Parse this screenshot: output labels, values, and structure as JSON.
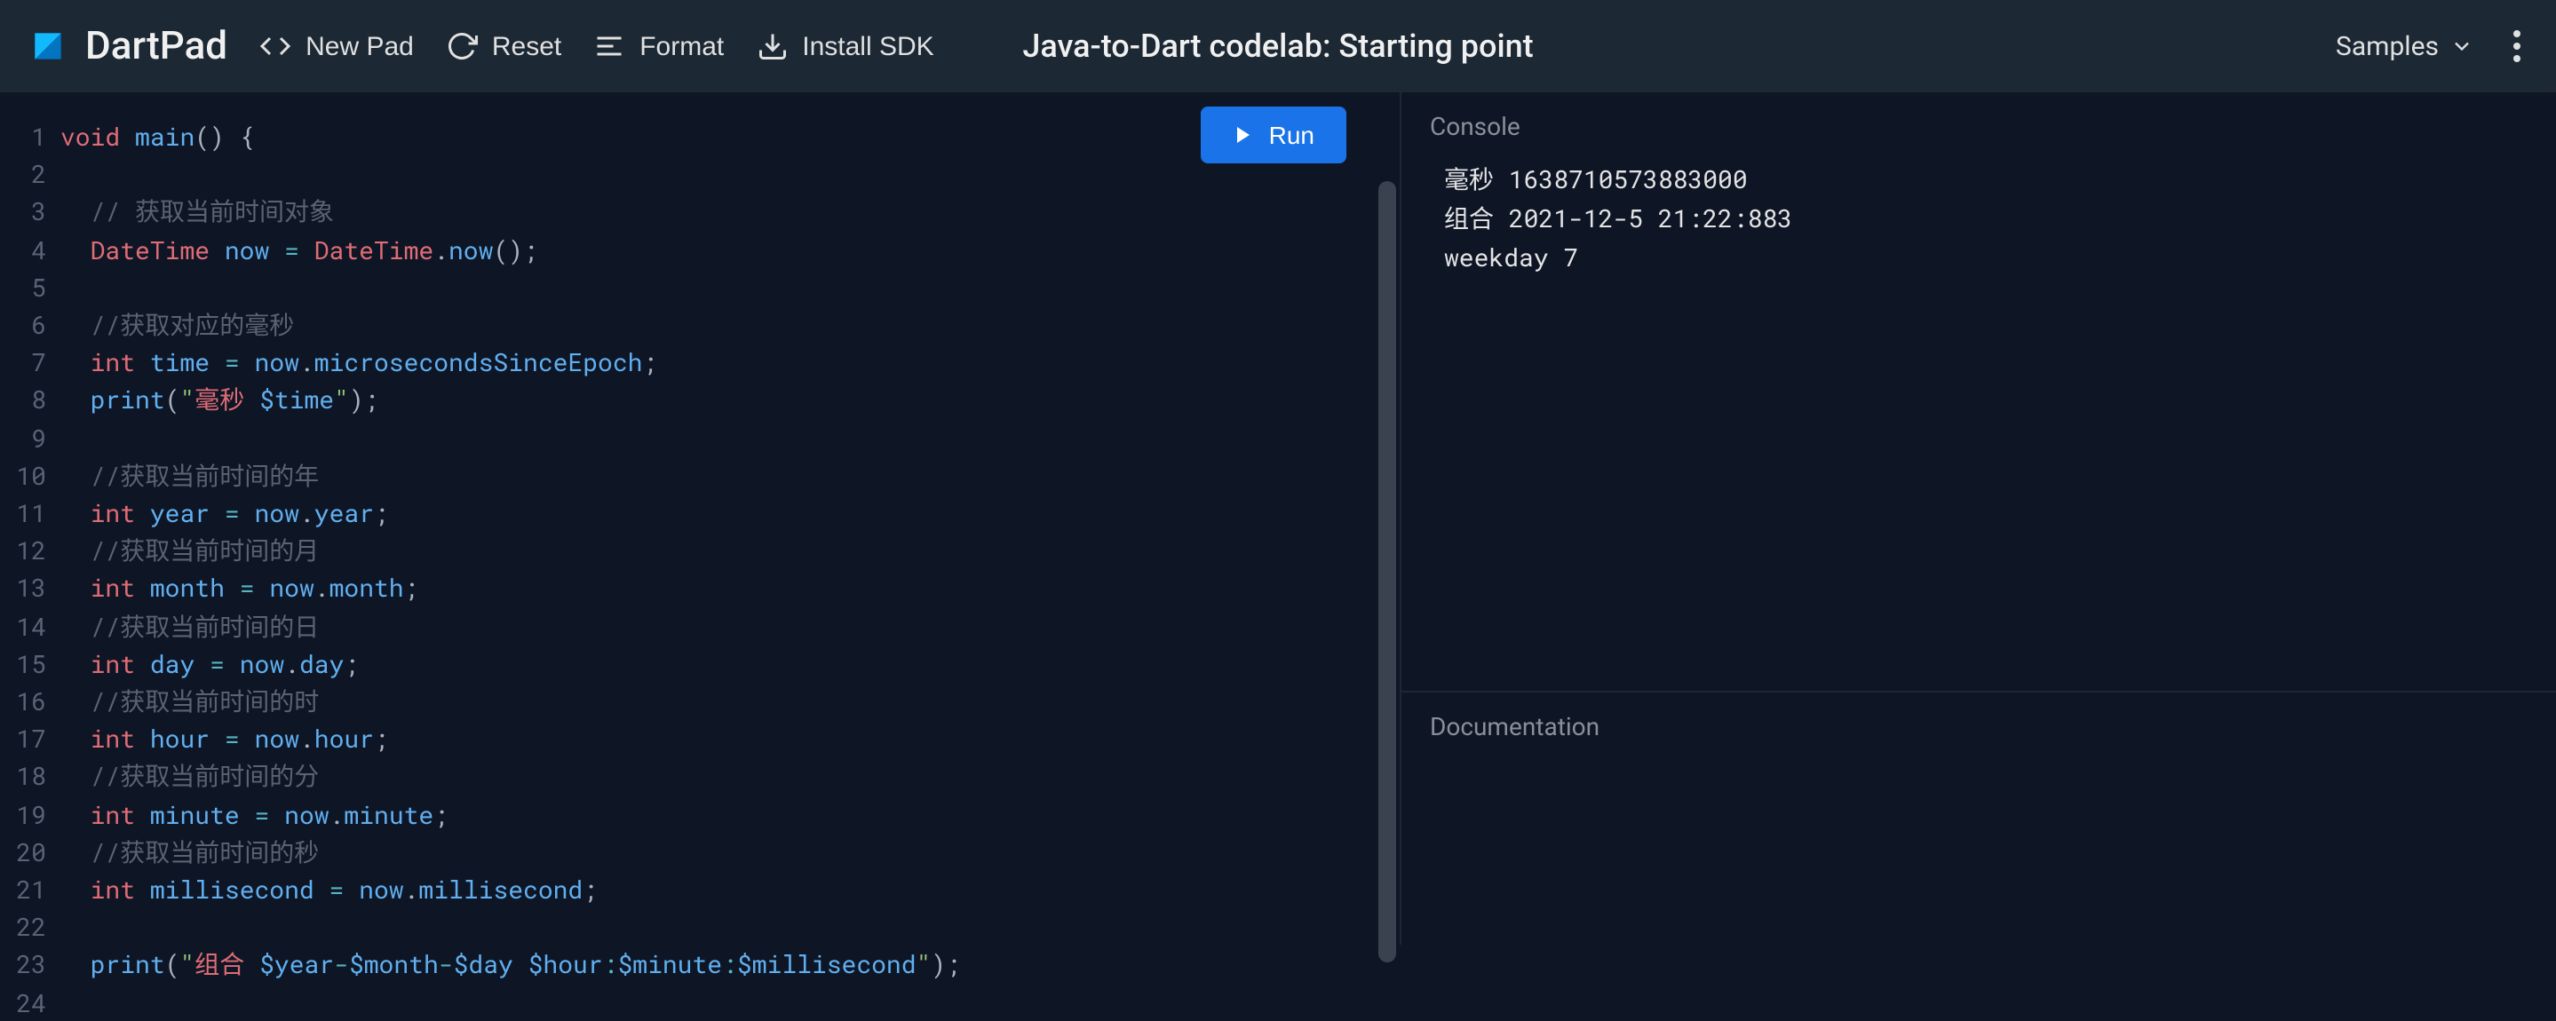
{
  "header": {
    "logo_text": "DartPad",
    "new_pad": "New Pad",
    "reset": "Reset",
    "format": "Format",
    "install_sdk": "Install SDK",
    "title": "Java-to-Dart codelab: Starting point",
    "samples": "Samples"
  },
  "run_button": "Run",
  "code_lines": [
    {
      "n": 1,
      "t": [
        [
          "kw",
          "void"
        ],
        [
          "p",
          " "
        ],
        [
          "fn",
          "main"
        ],
        [
          "punc",
          "() {"
        ]
      ]
    },
    {
      "n": 2,
      "t": []
    },
    {
      "n": 3,
      "t": [
        [
          "p",
          "  "
        ],
        [
          "cmt",
          "// 获取当前时间对象"
        ]
      ]
    },
    {
      "n": 4,
      "t": [
        [
          "p",
          "  "
        ],
        [
          "type",
          "DateTime"
        ],
        [
          "p",
          " "
        ],
        [
          "ident",
          "now"
        ],
        [
          "p",
          " "
        ],
        [
          "op",
          "="
        ],
        [
          "p",
          " "
        ],
        [
          "type",
          "DateTime"
        ],
        [
          "punc",
          "."
        ],
        [
          "fn",
          "now"
        ],
        [
          "punc",
          "();"
        ]
      ]
    },
    {
      "n": 5,
      "t": []
    },
    {
      "n": 6,
      "t": [
        [
          "p",
          "  "
        ],
        [
          "cmt",
          "//获取对应的毫秒"
        ]
      ]
    },
    {
      "n": 7,
      "t": [
        [
          "p",
          "  "
        ],
        [
          "kw",
          "int"
        ],
        [
          "p",
          " "
        ],
        [
          "ident",
          "time"
        ],
        [
          "p",
          " "
        ],
        [
          "op",
          "="
        ],
        [
          "p",
          " "
        ],
        [
          "ident",
          "now"
        ],
        [
          "punc",
          "."
        ],
        [
          "ident",
          "microsecondsSinceEpoch"
        ],
        [
          "punc",
          ";"
        ]
      ]
    },
    {
      "n": 8,
      "t": [
        [
          "p",
          "  "
        ],
        [
          "fn",
          "print"
        ],
        [
          "punc",
          "("
        ],
        [
          "str",
          "\""
        ],
        [
          "str-zh",
          "毫秒 "
        ],
        [
          "interp",
          "$time"
        ],
        [
          "str",
          "\""
        ],
        [
          "punc",
          ");"
        ]
      ]
    },
    {
      "n": 9,
      "t": []
    },
    {
      "n": 10,
      "t": [
        [
          "p",
          "  "
        ],
        [
          "cmt",
          "//获取当前时间的年"
        ]
      ]
    },
    {
      "n": 11,
      "t": [
        [
          "p",
          "  "
        ],
        [
          "kw",
          "int"
        ],
        [
          "p",
          " "
        ],
        [
          "ident",
          "year"
        ],
        [
          "p",
          " "
        ],
        [
          "op",
          "="
        ],
        [
          "p",
          " "
        ],
        [
          "ident",
          "now"
        ],
        [
          "punc",
          "."
        ],
        [
          "ident",
          "year"
        ],
        [
          "punc",
          ";"
        ]
      ]
    },
    {
      "n": 12,
      "t": [
        [
          "p",
          "  "
        ],
        [
          "cmt",
          "//获取当前时间的月"
        ]
      ]
    },
    {
      "n": 13,
      "t": [
        [
          "p",
          "  "
        ],
        [
          "kw",
          "int"
        ],
        [
          "p",
          " "
        ],
        [
          "ident",
          "month"
        ],
        [
          "p",
          " "
        ],
        [
          "op",
          "="
        ],
        [
          "p",
          " "
        ],
        [
          "ident",
          "now"
        ],
        [
          "punc",
          "."
        ],
        [
          "ident",
          "month"
        ],
        [
          "punc",
          ";"
        ]
      ]
    },
    {
      "n": 14,
      "t": [
        [
          "p",
          "  "
        ],
        [
          "cmt",
          "//获取当前时间的日"
        ]
      ]
    },
    {
      "n": 15,
      "t": [
        [
          "p",
          "  "
        ],
        [
          "kw",
          "int"
        ],
        [
          "p",
          " "
        ],
        [
          "ident",
          "day"
        ],
        [
          "p",
          " "
        ],
        [
          "op",
          "="
        ],
        [
          "p",
          " "
        ],
        [
          "ident",
          "now"
        ],
        [
          "punc",
          "."
        ],
        [
          "ident",
          "day"
        ],
        [
          "punc",
          ";"
        ]
      ]
    },
    {
      "n": 16,
      "t": [
        [
          "p",
          "  "
        ],
        [
          "cmt",
          "//获取当前时间的时"
        ]
      ]
    },
    {
      "n": 17,
      "t": [
        [
          "p",
          "  "
        ],
        [
          "kw",
          "int"
        ],
        [
          "p",
          " "
        ],
        [
          "ident",
          "hour"
        ],
        [
          "p",
          " "
        ],
        [
          "op",
          "="
        ],
        [
          "p",
          " "
        ],
        [
          "ident",
          "now"
        ],
        [
          "punc",
          "."
        ],
        [
          "ident",
          "hour"
        ],
        [
          "punc",
          ";"
        ]
      ]
    },
    {
      "n": 18,
      "t": [
        [
          "p",
          "  "
        ],
        [
          "cmt",
          "//获取当前时间的分"
        ]
      ]
    },
    {
      "n": 19,
      "t": [
        [
          "p",
          "  "
        ],
        [
          "kw",
          "int"
        ],
        [
          "p",
          " "
        ],
        [
          "ident",
          "minute"
        ],
        [
          "p",
          " "
        ],
        [
          "op",
          "="
        ],
        [
          "p",
          " "
        ],
        [
          "ident",
          "now"
        ],
        [
          "punc",
          "."
        ],
        [
          "ident",
          "minute"
        ],
        [
          "punc",
          ";"
        ]
      ]
    },
    {
      "n": 20,
      "t": [
        [
          "p",
          "  "
        ],
        [
          "cmt",
          "//获取当前时间的秒"
        ]
      ]
    },
    {
      "n": 21,
      "t": [
        [
          "p",
          "  "
        ],
        [
          "kw",
          "int"
        ],
        [
          "p",
          " "
        ],
        [
          "ident",
          "millisecond"
        ],
        [
          "p",
          " "
        ],
        [
          "op",
          "="
        ],
        [
          "p",
          " "
        ],
        [
          "ident",
          "now"
        ],
        [
          "punc",
          "."
        ],
        [
          "ident",
          "millisecond"
        ],
        [
          "punc",
          ";"
        ]
      ]
    },
    {
      "n": 22,
      "t": []
    },
    {
      "n": 23,
      "t": [
        [
          "p",
          "  "
        ],
        [
          "fn",
          "print"
        ],
        [
          "punc",
          "("
        ],
        [
          "str",
          "\""
        ],
        [
          "str-zh",
          "组合 "
        ],
        [
          "interp",
          "$year"
        ],
        [
          "op",
          "-"
        ],
        [
          "interp",
          "$month"
        ],
        [
          "op",
          "-"
        ],
        [
          "interp",
          "$day"
        ],
        [
          "str",
          " "
        ],
        [
          "interp",
          "$hour"
        ],
        [
          "op",
          ":"
        ],
        [
          "interp",
          "$minute"
        ],
        [
          "op",
          ":"
        ],
        [
          "interp",
          "$millisecond"
        ],
        [
          "str",
          "\""
        ],
        [
          "punc",
          ");"
        ]
      ]
    },
    {
      "n": 24,
      "t": []
    }
  ],
  "console": {
    "title": "Console",
    "lines": [
      "毫秒 1638710573883000",
      "组合 2021-12-5 21:22:883",
      "weekday 7"
    ]
  },
  "documentation": {
    "title": "Documentation"
  }
}
